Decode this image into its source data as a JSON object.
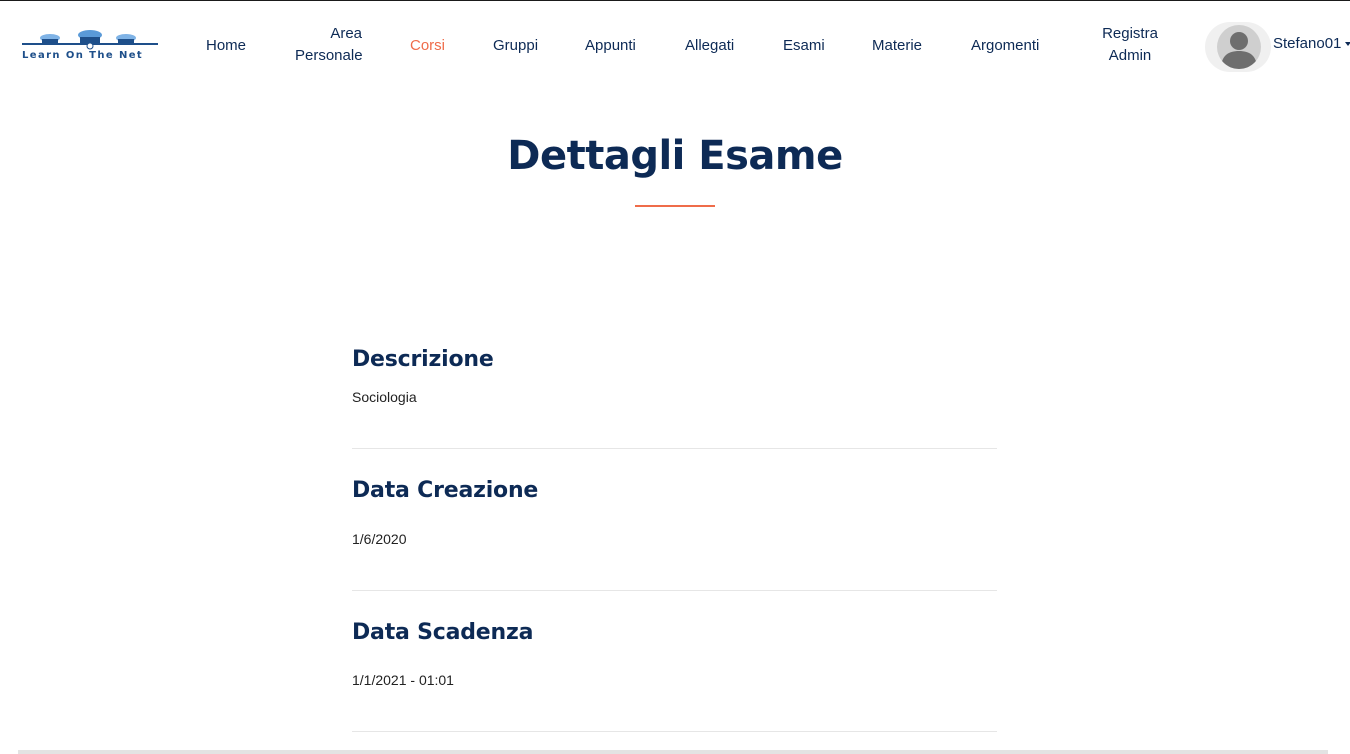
{
  "brand": {
    "logo_text": "Learn On The Net",
    "accent": "#ef6c4a",
    "primary": "#0d2a55"
  },
  "nav": {
    "home": "Home",
    "area_line1": "Area",
    "area_line2": "Personale",
    "corsi": "Corsi",
    "gruppi": "Gruppi",
    "appunti": "Appunti",
    "allegati": "Allegati",
    "esami": "Esami",
    "materie": "Materie",
    "argomenti": "Argomenti",
    "registra_line1": "Registra",
    "registra_line2": "Admin",
    "active": "Corsi"
  },
  "user": {
    "name": "Stefano01",
    "avatar_icon": "user-avatar-icon"
  },
  "page": {
    "title": "Dettagli Esame"
  },
  "details": {
    "descrizione_label": "Descrizione",
    "descrizione_value": "Sociologia",
    "creazione_label": "Data Creazione",
    "creazione_value": "1/6/2020",
    "scadenza_label": "Data Scadenza",
    "scadenza_value": "1/1/2021 - 01:01"
  }
}
